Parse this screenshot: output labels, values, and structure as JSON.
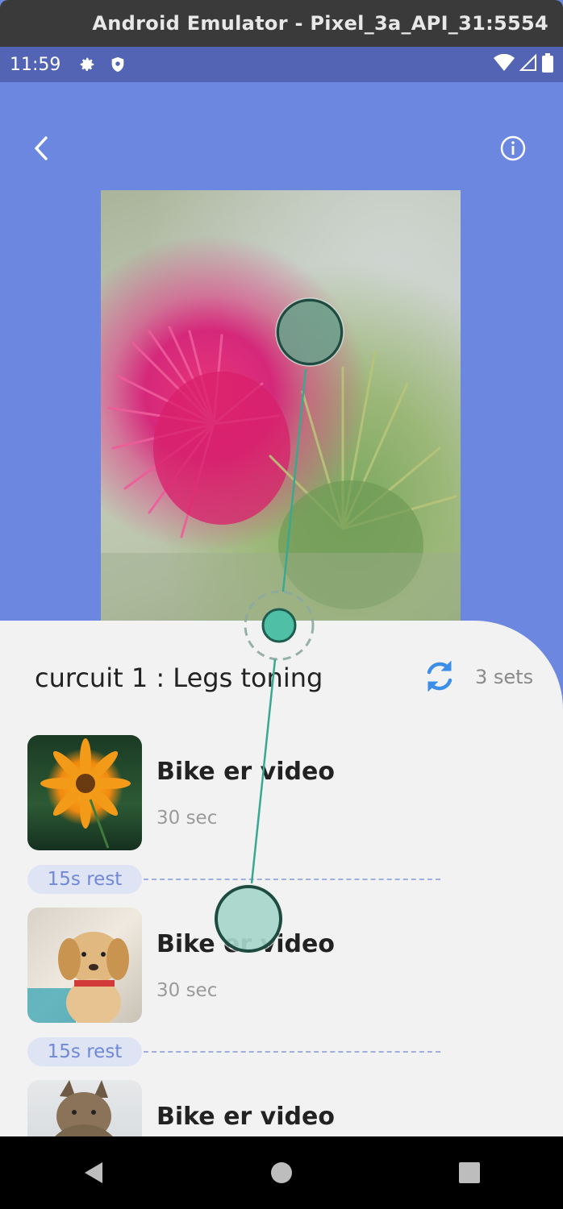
{
  "window": {
    "title": "Android Emulator - Pixel_3a_API_31:5554"
  },
  "status_bar": {
    "time": "11:59",
    "icons_left": [
      "gear-icon",
      "shield-icon"
    ],
    "icons_right": [
      "wifi-icon",
      "signal-icon",
      "battery-icon"
    ]
  },
  "header": {
    "back_icon": "chevron-left-icon",
    "info_icon": "info-icon",
    "background_color": "#6b87e0"
  },
  "circuit": {
    "title": "curcuit 1 : Legs toning",
    "sets": "3 sets",
    "refresh_icon": "refresh-icon",
    "accent_color": "#3d8ee6"
  },
  "exercises": [
    {
      "title": "Bike er video",
      "duration": "30 sec",
      "thumbnail": "orange-flower-image"
    },
    {
      "title": "Bike er video",
      "duration": "30 sec",
      "thumbnail": "puppy-image"
    },
    {
      "title": "Bike er video",
      "duration": "",
      "thumbnail": "cat-image"
    }
  ],
  "rests": [
    {
      "label": "15s rest"
    },
    {
      "label": "15s rest"
    }
  ],
  "nav": {
    "back": "nav-back-icon",
    "home": "nav-home-icon",
    "recents": "nav-recents-icon"
  }
}
